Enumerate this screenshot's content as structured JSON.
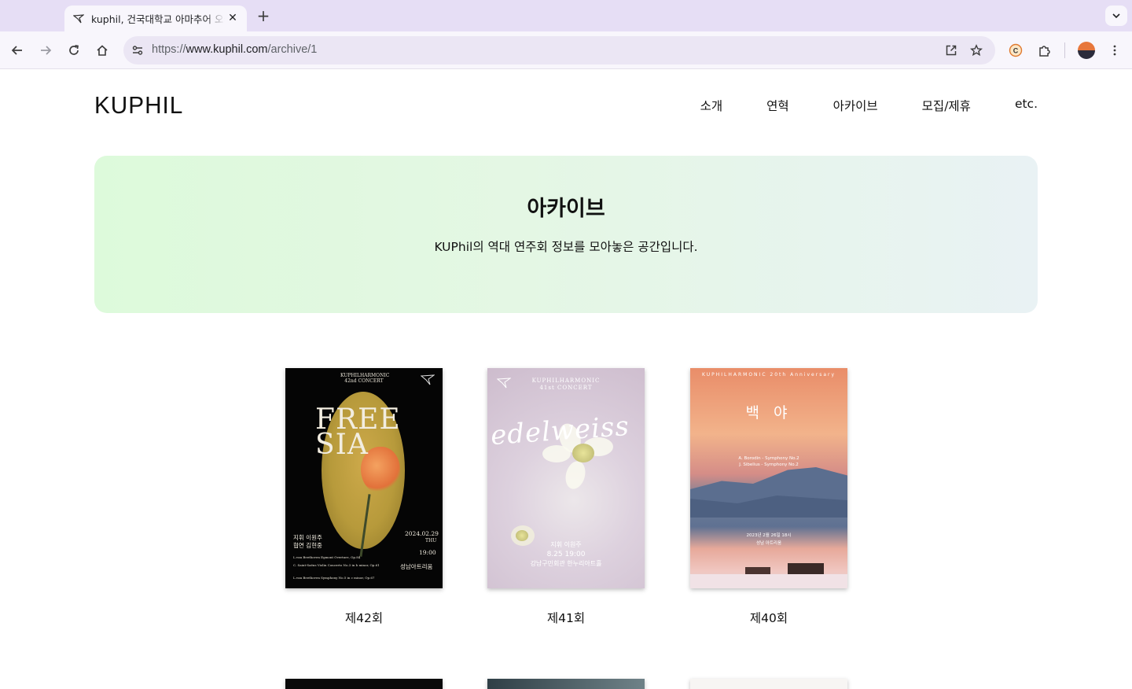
{
  "browser": {
    "tab_title": "kuphil, 건국대학교 아마추어 오케스트라",
    "new_tab_label": "+",
    "url_prefix": "https://",
    "url_host": "www.kuphil.com",
    "url_path": "/archive/1",
    "extension_letter": "C"
  },
  "site": {
    "logo": "KUPHIL",
    "nav": [
      "소개",
      "연혁",
      "아카이브",
      "모집/제휴",
      "etc."
    ]
  },
  "hero": {
    "title": "아카이브",
    "subtitle": "KUPhil의 역대 연주회 정보를 모아놓은 공간입니다."
  },
  "archive": [
    {
      "label": "제42회",
      "poster": {
        "header": "KUPHILHARMONIC\n42nd CONCERT",
        "title_line1": "FREE",
        "title_line2": "SIA",
        "date": "2024.02.29",
        "weekday": "THU",
        "time": "19:00",
        "conductor": "지휘 이원주",
        "soloist": "협연 김현중",
        "venue": "성남아트리움",
        "program": [
          "L.van Beethoven Egmont Overture, Op.84",
          "C. Saint-Saëns Violin Concerto No.3 in b minor, Op.61",
          "L.van Beethoven Symphony No.5 in c minor, Op.67"
        ]
      }
    },
    {
      "label": "제41회",
      "poster": {
        "header": "KUPHILHARMONIC\n41st CONCERT",
        "title": "edelweiss",
        "conductor": "지휘 이원주",
        "date_time": "8.25 19:00",
        "venue": "강남구민회관 한누리아트홀"
      }
    },
    {
      "label": "제40회",
      "poster": {
        "header": "KUPHILHARMONIC 20th Anniversary",
        "title": "백 야",
        "date": "2023년 2월 26일 18시",
        "venue": "성남 아트리움",
        "program": [
          "A. Borodin - Symphony No.2",
          "J. Sibelius - Symphony No.2"
        ]
      }
    }
  ],
  "colors": {
    "hero_start": "#ddfadb",
    "hero_end": "#e9f2f4",
    "chrome_tabstrip": "#e6def5",
    "chrome_toolbar": "#f8f6fc"
  }
}
